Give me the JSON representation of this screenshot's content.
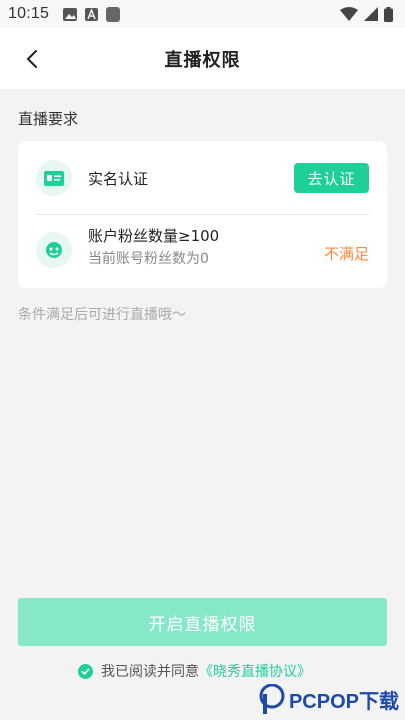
{
  "status_bar": {
    "time": "10:15"
  },
  "header": {
    "title": "直播权限"
  },
  "requirements": {
    "section_title": "直播要求",
    "items": [
      {
        "label": "实名认证",
        "action_label": "去认证",
        "icon": "id-card-icon"
      },
      {
        "label": "账户粉丝数量≥100",
        "sub": "当前账号粉丝数为0",
        "status": "不满足",
        "icon": "fans-icon"
      }
    ]
  },
  "hint": "条件满足后可进行直播哦～",
  "start_button": {
    "label": "开启直播权限"
  },
  "agreement": {
    "prefix": "我已阅读并同意",
    "link": "《晓秀直播协议》"
  },
  "watermark": {
    "text": "PCPOP下载"
  },
  "colors": {
    "accent": "#1fcf9a",
    "accent_light": "#86e8c8",
    "warning": "#ff8a3d"
  }
}
